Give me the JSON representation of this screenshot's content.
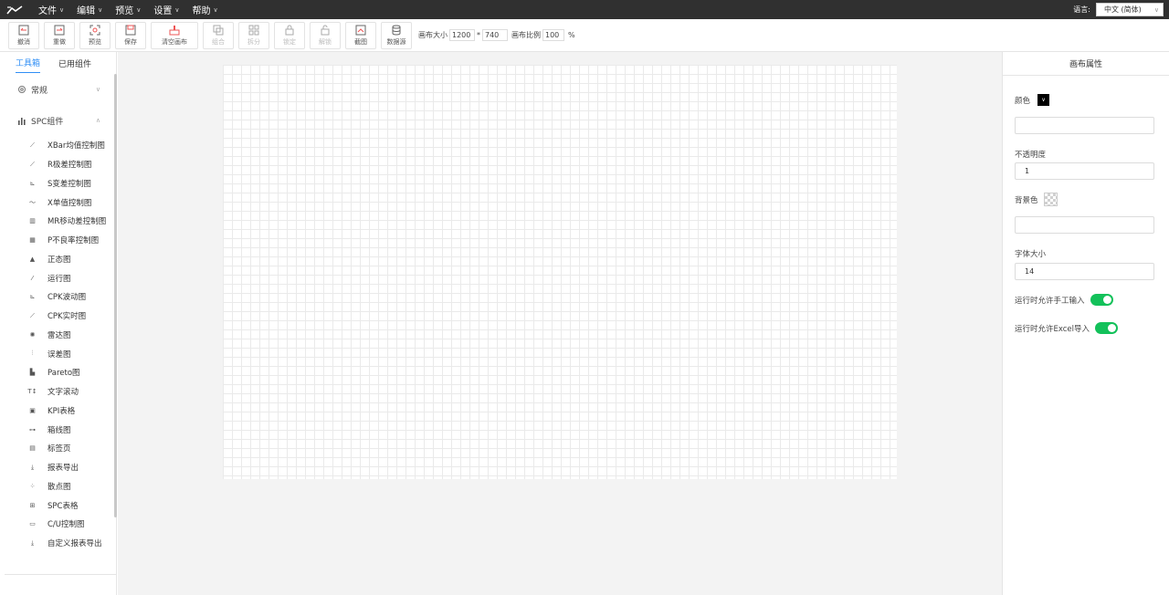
{
  "menubar": {
    "items": [
      {
        "label": "文件"
      },
      {
        "label": "编辑"
      },
      {
        "label": "预览"
      },
      {
        "label": "设置"
      },
      {
        "label": "帮助"
      }
    ],
    "language_label": "语言:",
    "language_value": "中文 (简体)"
  },
  "toolbar": {
    "buttons": [
      {
        "label": "撤消",
        "icon": "undo-icon",
        "enabled": true
      },
      {
        "label": "重做",
        "icon": "redo-icon",
        "enabled": true
      },
      {
        "label": "预览",
        "icon": "preview-icon",
        "enabled": true
      },
      {
        "label": "保存",
        "icon": "save-icon",
        "enabled": true
      },
      {
        "label": "清空画布",
        "icon": "clear-canvas-icon",
        "enabled": true
      },
      {
        "label": "组合",
        "icon": "group-icon",
        "enabled": false
      },
      {
        "label": "拆分",
        "icon": "ungroup-icon",
        "enabled": false
      },
      {
        "label": "锁定",
        "icon": "lock-icon",
        "enabled": false
      },
      {
        "label": "解锁",
        "icon": "unlock-icon",
        "enabled": false
      },
      {
        "label": "截图",
        "icon": "screenshot-icon",
        "enabled": true
      },
      {
        "label": "数据源",
        "icon": "datasource-icon",
        "enabled": true
      }
    ],
    "canvas_size_label": "画布大小",
    "canvas_width": "1200",
    "times": "*",
    "canvas_height": "740",
    "canvas_ratio_label": "画布比例",
    "canvas_ratio": "100",
    "percent": "%"
  },
  "leftpanel": {
    "tabs": [
      {
        "label": "工具箱",
        "active": true
      },
      {
        "label": "已用组件",
        "active": false
      }
    ],
    "sections": [
      {
        "label": "常规",
        "icon": "gear-icon",
        "expanded": false
      },
      {
        "label": "SPC组件",
        "icon": "bar-chart-icon",
        "expanded": true
      }
    ],
    "items": [
      {
        "label": "XBar均值控制图",
        "icon": "line-chart-icon"
      },
      {
        "label": "R极差控制图",
        "icon": "line-chart-icon"
      },
      {
        "label": "S变差控制图",
        "icon": "line-chart-icon"
      },
      {
        "label": "X单值控制图",
        "icon": "line-chart-icon"
      },
      {
        "label": "MR移动差控制图",
        "icon": "bar-chart-icon"
      },
      {
        "label": "P不良率控制图",
        "icon": "bar-chart-icon"
      },
      {
        "label": "正态图",
        "icon": "histogram-icon"
      },
      {
        "label": "运行图",
        "icon": "run-chart-icon"
      },
      {
        "label": "CPK波动图",
        "icon": "line-chart-icon"
      },
      {
        "label": "CPK实时图",
        "icon": "line-chart-icon"
      },
      {
        "label": "雷达图",
        "icon": "radar-icon"
      },
      {
        "label": "误差图",
        "icon": "error-chart-icon"
      },
      {
        "label": "Pareto图",
        "icon": "pareto-icon"
      },
      {
        "label": "文字滚动",
        "icon": "text-scroll-icon"
      },
      {
        "label": "KPI表格",
        "icon": "kpi-icon"
      },
      {
        "label": "箱线图",
        "icon": "boxplot-icon"
      },
      {
        "label": "标签页",
        "icon": "tabs-icon"
      },
      {
        "label": "报表导出",
        "icon": "download-icon"
      },
      {
        "label": "散点图",
        "icon": "scatter-icon"
      },
      {
        "label": "SPC表格",
        "icon": "table-icon"
      },
      {
        "label": "C/U控制图",
        "icon": "cu-chart-icon"
      },
      {
        "label": "自定义报表导出",
        "icon": "download-icon"
      }
    ]
  },
  "rightpanel": {
    "title": "画布属性",
    "color_label": "颜色",
    "color_value": "",
    "color_swatch": "#000000",
    "opacity_label": "不透明度",
    "opacity_value": "1",
    "bgcolor_label": "背景色",
    "bgcolor_value": "",
    "fontsize_label": "字体大小",
    "fontsize_value": "14",
    "allow_manual_label": "运行时允许手工输入",
    "allow_manual_on": true,
    "allow_excel_label": "运行时允许Excel导入",
    "allow_excel_on": true,
    "accent": "#13c15a",
    "link_color": "#2f8ef5"
  }
}
